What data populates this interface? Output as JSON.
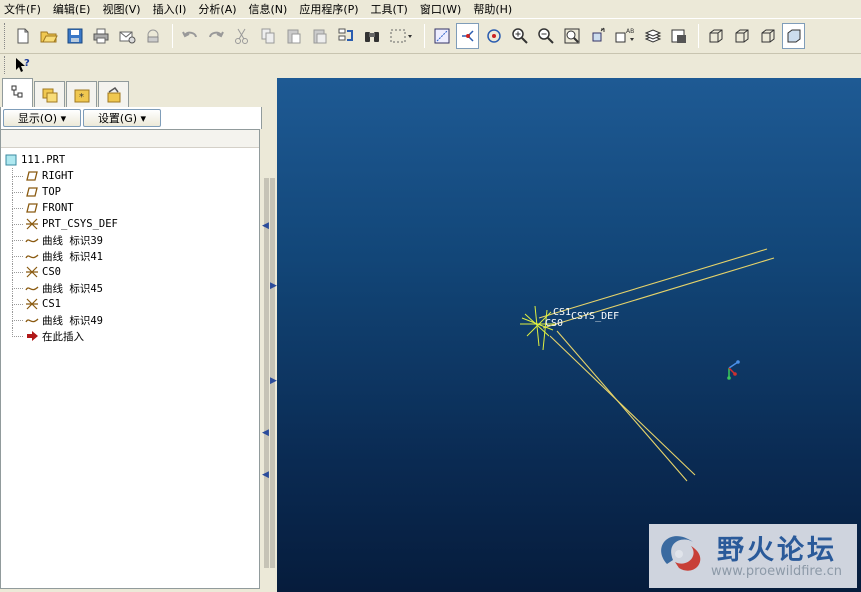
{
  "menu": [
    {
      "label": "文件(F)"
    },
    {
      "label": "编辑(E)"
    },
    {
      "label": "视图(V)"
    },
    {
      "label": "插入(I)"
    },
    {
      "label": "分析(A)"
    },
    {
      "label": "信息(N)"
    },
    {
      "label": "应用程序(P)"
    },
    {
      "label": "工具(T)"
    },
    {
      "label": "窗口(W)"
    },
    {
      "label": "帮助(H)"
    }
  ],
  "panel": {
    "show_label": "显示(O) ▾",
    "settings_label": "设置(G) ▾"
  },
  "tree": {
    "root": "111.PRT",
    "items": [
      {
        "label": "RIGHT",
        "icon": "datum-plane-icon"
      },
      {
        "label": "TOP",
        "icon": "datum-plane-icon"
      },
      {
        "label": "FRONT",
        "icon": "datum-plane-icon"
      },
      {
        "label": "PRT_CSYS_DEF",
        "icon": "csys-icon"
      },
      {
        "label": "曲线 标识39",
        "icon": "curve-icon"
      },
      {
        "label": "曲线 标识41",
        "icon": "curve-icon"
      },
      {
        "label": "CS0",
        "icon": "csys-icon"
      },
      {
        "label": "曲线 标识45",
        "icon": "curve-icon"
      },
      {
        "label": "CS1",
        "icon": "csys-icon"
      },
      {
        "label": "曲线 标识49",
        "icon": "curve-icon"
      },
      {
        "label": "在此插入",
        "icon": "insert-here-arrow-icon"
      }
    ]
  },
  "viewport": {
    "csys_labels": [
      "CS1",
      "CS0",
      "CSYS_DEF"
    ],
    "watermark_title": "野火论坛",
    "watermark_url": "www.proewildfire.cn"
  },
  "colors": {
    "viewport_top": "#1e5a94",
    "viewport_bottom": "#061c3c",
    "curve": "#e6d36a",
    "csys": "#e0f040"
  }
}
